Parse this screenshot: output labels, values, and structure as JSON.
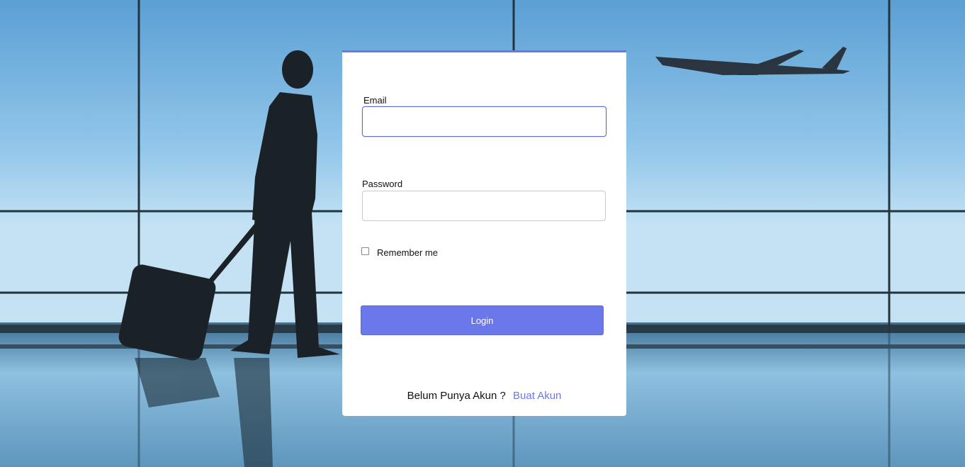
{
  "login_form": {
    "email_label": "Email",
    "email_value": "",
    "password_label": "Password",
    "password_value": "",
    "remember_label": "Remember me",
    "remember_checked": false,
    "login_label": "Login",
    "no_account_text": "Belum Punya Akun ?",
    "create_account_link": "Buat Akun"
  },
  "colors": {
    "accent": "#6a78ec"
  }
}
